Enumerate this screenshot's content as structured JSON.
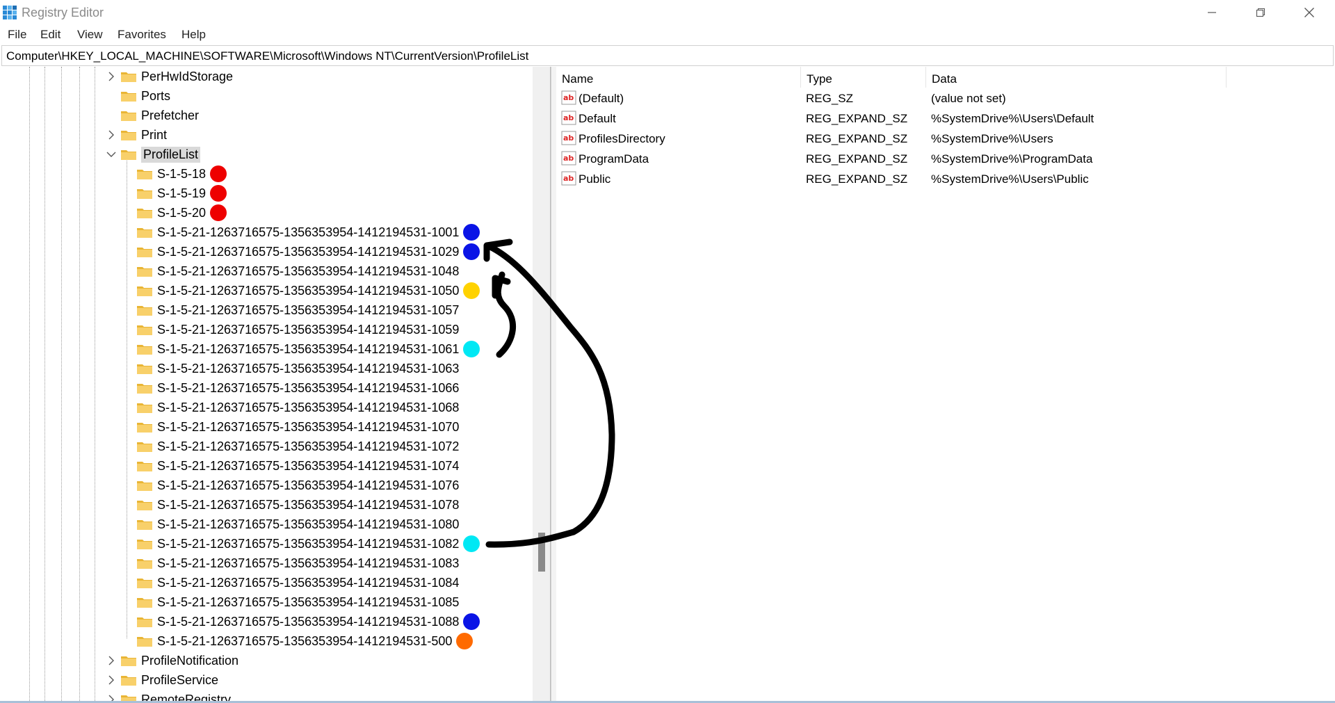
{
  "window": {
    "title": "Registry Editor",
    "app_icon": "regedit-icon",
    "controls": [
      "minimize-icon",
      "restore-icon",
      "close-icon"
    ]
  },
  "menu": [
    "File",
    "Edit",
    "View",
    "Favorites",
    "Help"
  ],
  "address": "Computer\\HKEY_LOCAL_MACHINE\\SOFTWARE\\Microsoft\\Windows NT\\CurrentVersion\\ProfileList",
  "tree": {
    "items": [
      {
        "label": "PerHwIdStorage",
        "expander": "collapsed"
      },
      {
        "label": "Ports",
        "expander": "none"
      },
      {
        "label": "Prefetcher",
        "expander": "none"
      },
      {
        "label": "Print",
        "expander": "collapsed"
      },
      {
        "label": "ProfileList",
        "expander": "expanded",
        "selected": true
      },
      {
        "label": "S-1-5-18",
        "marker": "#ee0000"
      },
      {
        "label": "S-1-5-19",
        "marker": "#ee0000"
      },
      {
        "label": "S-1-5-20",
        "marker": "#ee0000"
      },
      {
        "label": "S-1-5-21-1263716575-1356353954-1412194531-1001",
        "marker": "#0a14e6"
      },
      {
        "label": "S-1-5-21-1263716575-1356353954-1412194531-1029",
        "marker": "#0a14e6"
      },
      {
        "label": "S-1-5-21-1263716575-1356353954-1412194531-1048"
      },
      {
        "label": "S-1-5-21-1263716575-1356353954-1412194531-1050",
        "marker": "#ffd200"
      },
      {
        "label": "S-1-5-21-1263716575-1356353954-1412194531-1057"
      },
      {
        "label": "S-1-5-21-1263716575-1356353954-1412194531-1059"
      },
      {
        "label": "S-1-5-21-1263716575-1356353954-1412194531-1061",
        "marker": "#00e8f4"
      },
      {
        "label": "S-1-5-21-1263716575-1356353954-1412194531-1063"
      },
      {
        "label": "S-1-5-21-1263716575-1356353954-1412194531-1066"
      },
      {
        "label": "S-1-5-21-1263716575-1356353954-1412194531-1068"
      },
      {
        "label": "S-1-5-21-1263716575-1356353954-1412194531-1070"
      },
      {
        "label": "S-1-5-21-1263716575-1356353954-1412194531-1072"
      },
      {
        "label": "S-1-5-21-1263716575-1356353954-1412194531-1074"
      },
      {
        "label": "S-1-5-21-1263716575-1356353954-1412194531-1076"
      },
      {
        "label": "S-1-5-21-1263716575-1356353954-1412194531-1078"
      },
      {
        "label": "S-1-5-21-1263716575-1356353954-1412194531-1080"
      },
      {
        "label": "S-1-5-21-1263716575-1356353954-1412194531-1082",
        "marker": "#00e8f4"
      },
      {
        "label": "S-1-5-21-1263716575-1356353954-1412194531-1083"
      },
      {
        "label": "S-1-5-21-1263716575-1356353954-1412194531-1084"
      },
      {
        "label": "S-1-5-21-1263716575-1356353954-1412194531-1085"
      },
      {
        "label": "S-1-5-21-1263716575-1356353954-1412194531-1088",
        "marker": "#0a14e6"
      },
      {
        "label": "S-1-5-21-1263716575-1356353954-1412194531-500",
        "marker": "#ff6a00"
      },
      {
        "label": "ProfileNotification",
        "expander": "collapsed"
      },
      {
        "label": "ProfileService",
        "expander": "collapsed"
      },
      {
        "label": "RemoteRegistry",
        "expander": "collapsed",
        "partially_visible": true
      }
    ]
  },
  "values": {
    "columns": [
      "Name",
      "Type",
      "Data"
    ],
    "rows": [
      {
        "name": "(Default)",
        "type": "REG_SZ",
        "data": "(value not set)",
        "icon": "string-value-icon"
      },
      {
        "name": "Default",
        "type": "REG_EXPAND_SZ",
        "data": "%SystemDrive%\\Users\\Default",
        "icon": "string-value-icon"
      },
      {
        "name": "ProfilesDirectory",
        "type": "REG_EXPAND_SZ",
        "data": "%SystemDrive%\\Users",
        "icon": "string-value-icon"
      },
      {
        "name": "ProgramData",
        "type": "REG_EXPAND_SZ",
        "data": "%SystemDrive%\\ProgramData",
        "icon": "string-value-icon"
      },
      {
        "name": "Public",
        "type": "REG_EXPAND_SZ",
        "data": "%SystemDrive%\\Users\\Public",
        "icon": "string-value-icon"
      }
    ]
  },
  "annotations": {
    "stroke_color": "#000000",
    "arrows": [
      "arrow from S-1-5-21-1263716575-1356353954-1412194531-1082 to S-1-5-21-1263716575-1356353954-1412194531-1029",
      "arrow from S-1-5-21-1263716575-1356353954-1412194531-1061 to S-1-5-21-1263716575-1356353954-1412194531-1050"
    ]
  }
}
